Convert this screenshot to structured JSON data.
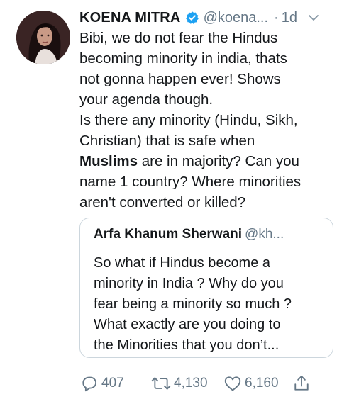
{
  "tweet": {
    "display_name": "KOENA MITRA",
    "handle": "@koena...",
    "separator": "·",
    "time": "1d",
    "text_lines": [
      "Bibi, we do not fear the Hindus",
      "becoming minority in india, thats",
      "not gonna happen ever! Shows",
      "your agenda though.",
      "Is there any minority (Hindu, Sikh,",
      "Christian) that is safe when"
    ],
    "bold_word": "Muslims",
    "line7_rest": " are in majority? Can you",
    "text_lines_end": [
      "name 1 country? Where minorities",
      "aren't converted or killed?"
    ]
  },
  "quote": {
    "display_name": "Arfa Khanum Sherwani",
    "handle": "@kh...",
    "text_lines": [
      "So what if Hindus become a",
      "minority in India ? Why do you",
      "fear being a minority so much ?",
      "What exactly are you doing to",
      "the Minorities that you don’t..."
    ]
  },
  "actions": {
    "reply_count": "407",
    "retweet_count": "4,130",
    "like_count": "6,160"
  },
  "icons": {
    "avatar": "avatar",
    "verified": "verified-badge-icon",
    "chevron": "chevron-down-icon",
    "reply": "reply-icon",
    "retweet": "retweet-icon",
    "like": "heart-icon",
    "share": "share-icon"
  },
  "colors": {
    "verified": "#1da1f2",
    "secondary_text": "#657786",
    "border": "#ccd6dd"
  }
}
